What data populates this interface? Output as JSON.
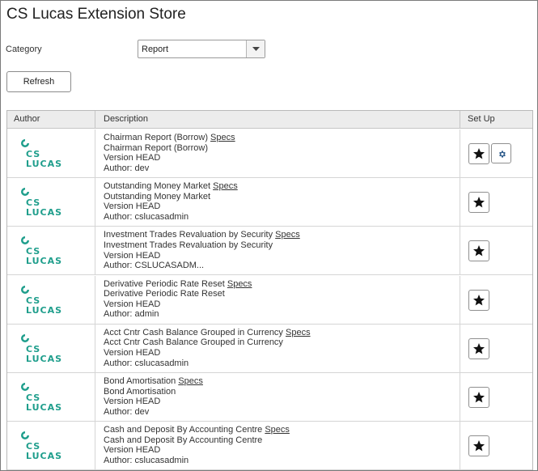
{
  "page": {
    "title": "CS Lucas Extension Store"
  },
  "filters": {
    "category_label": "Category",
    "category_value": "Report",
    "refresh_label": "Refresh"
  },
  "grid": {
    "headers": {
      "author": "Author",
      "description": "Description",
      "setup": "Set Up"
    },
    "logo_text": {
      "line1": "CS",
      "line2": "LUCAS"
    },
    "colors": {
      "logo": "#1f9e8c",
      "header_bg": "#ececec"
    },
    "rows": [
      {
        "title": "Chairman Report (Borrow)",
        "specs": "Specs",
        "subtitle": "Chairman Report (Borrow)",
        "version": "Version HEAD",
        "author": "Author: dev",
        "has_settings": true
      },
      {
        "title": "Outstanding Money Market",
        "specs": "Specs",
        "subtitle": "Outstanding Money Market",
        "version": "Version HEAD",
        "author": "Author: cslucasadmin",
        "has_settings": false
      },
      {
        "title": "Investment Trades Revaluation by Security",
        "specs": "Specs",
        "subtitle": "Investment Trades Revaluation by Security",
        "version": "Version HEAD",
        "author": "Author: CSLUCASADM...",
        "has_settings": false
      },
      {
        "title": "Derivative Periodic Rate Reset",
        "specs": "Specs",
        "subtitle": "Derivative Periodic Rate Reset",
        "version": "Version HEAD",
        "author": "Author: admin",
        "has_settings": false
      },
      {
        "title": "Acct Cntr Cash Balance Grouped in Currency",
        "specs": "Specs",
        "subtitle": "Acct Cntr Cash Balance Grouped in Currency",
        "version": "Version HEAD",
        "author": "Author: cslucasadmin",
        "has_settings": false
      },
      {
        "title": "Bond Amortisation",
        "specs": "Specs",
        "subtitle": "Bond Amortisation",
        "version": "Version HEAD",
        "author": "Author: dev",
        "has_settings": false
      },
      {
        "title": "Cash and Deposit By Accounting Centre",
        "specs": "Specs",
        "subtitle": "Cash and Deposit By Accounting Centre",
        "version": "Version HEAD",
        "author": "Author: cslucasadmin",
        "has_settings": false
      }
    ]
  }
}
